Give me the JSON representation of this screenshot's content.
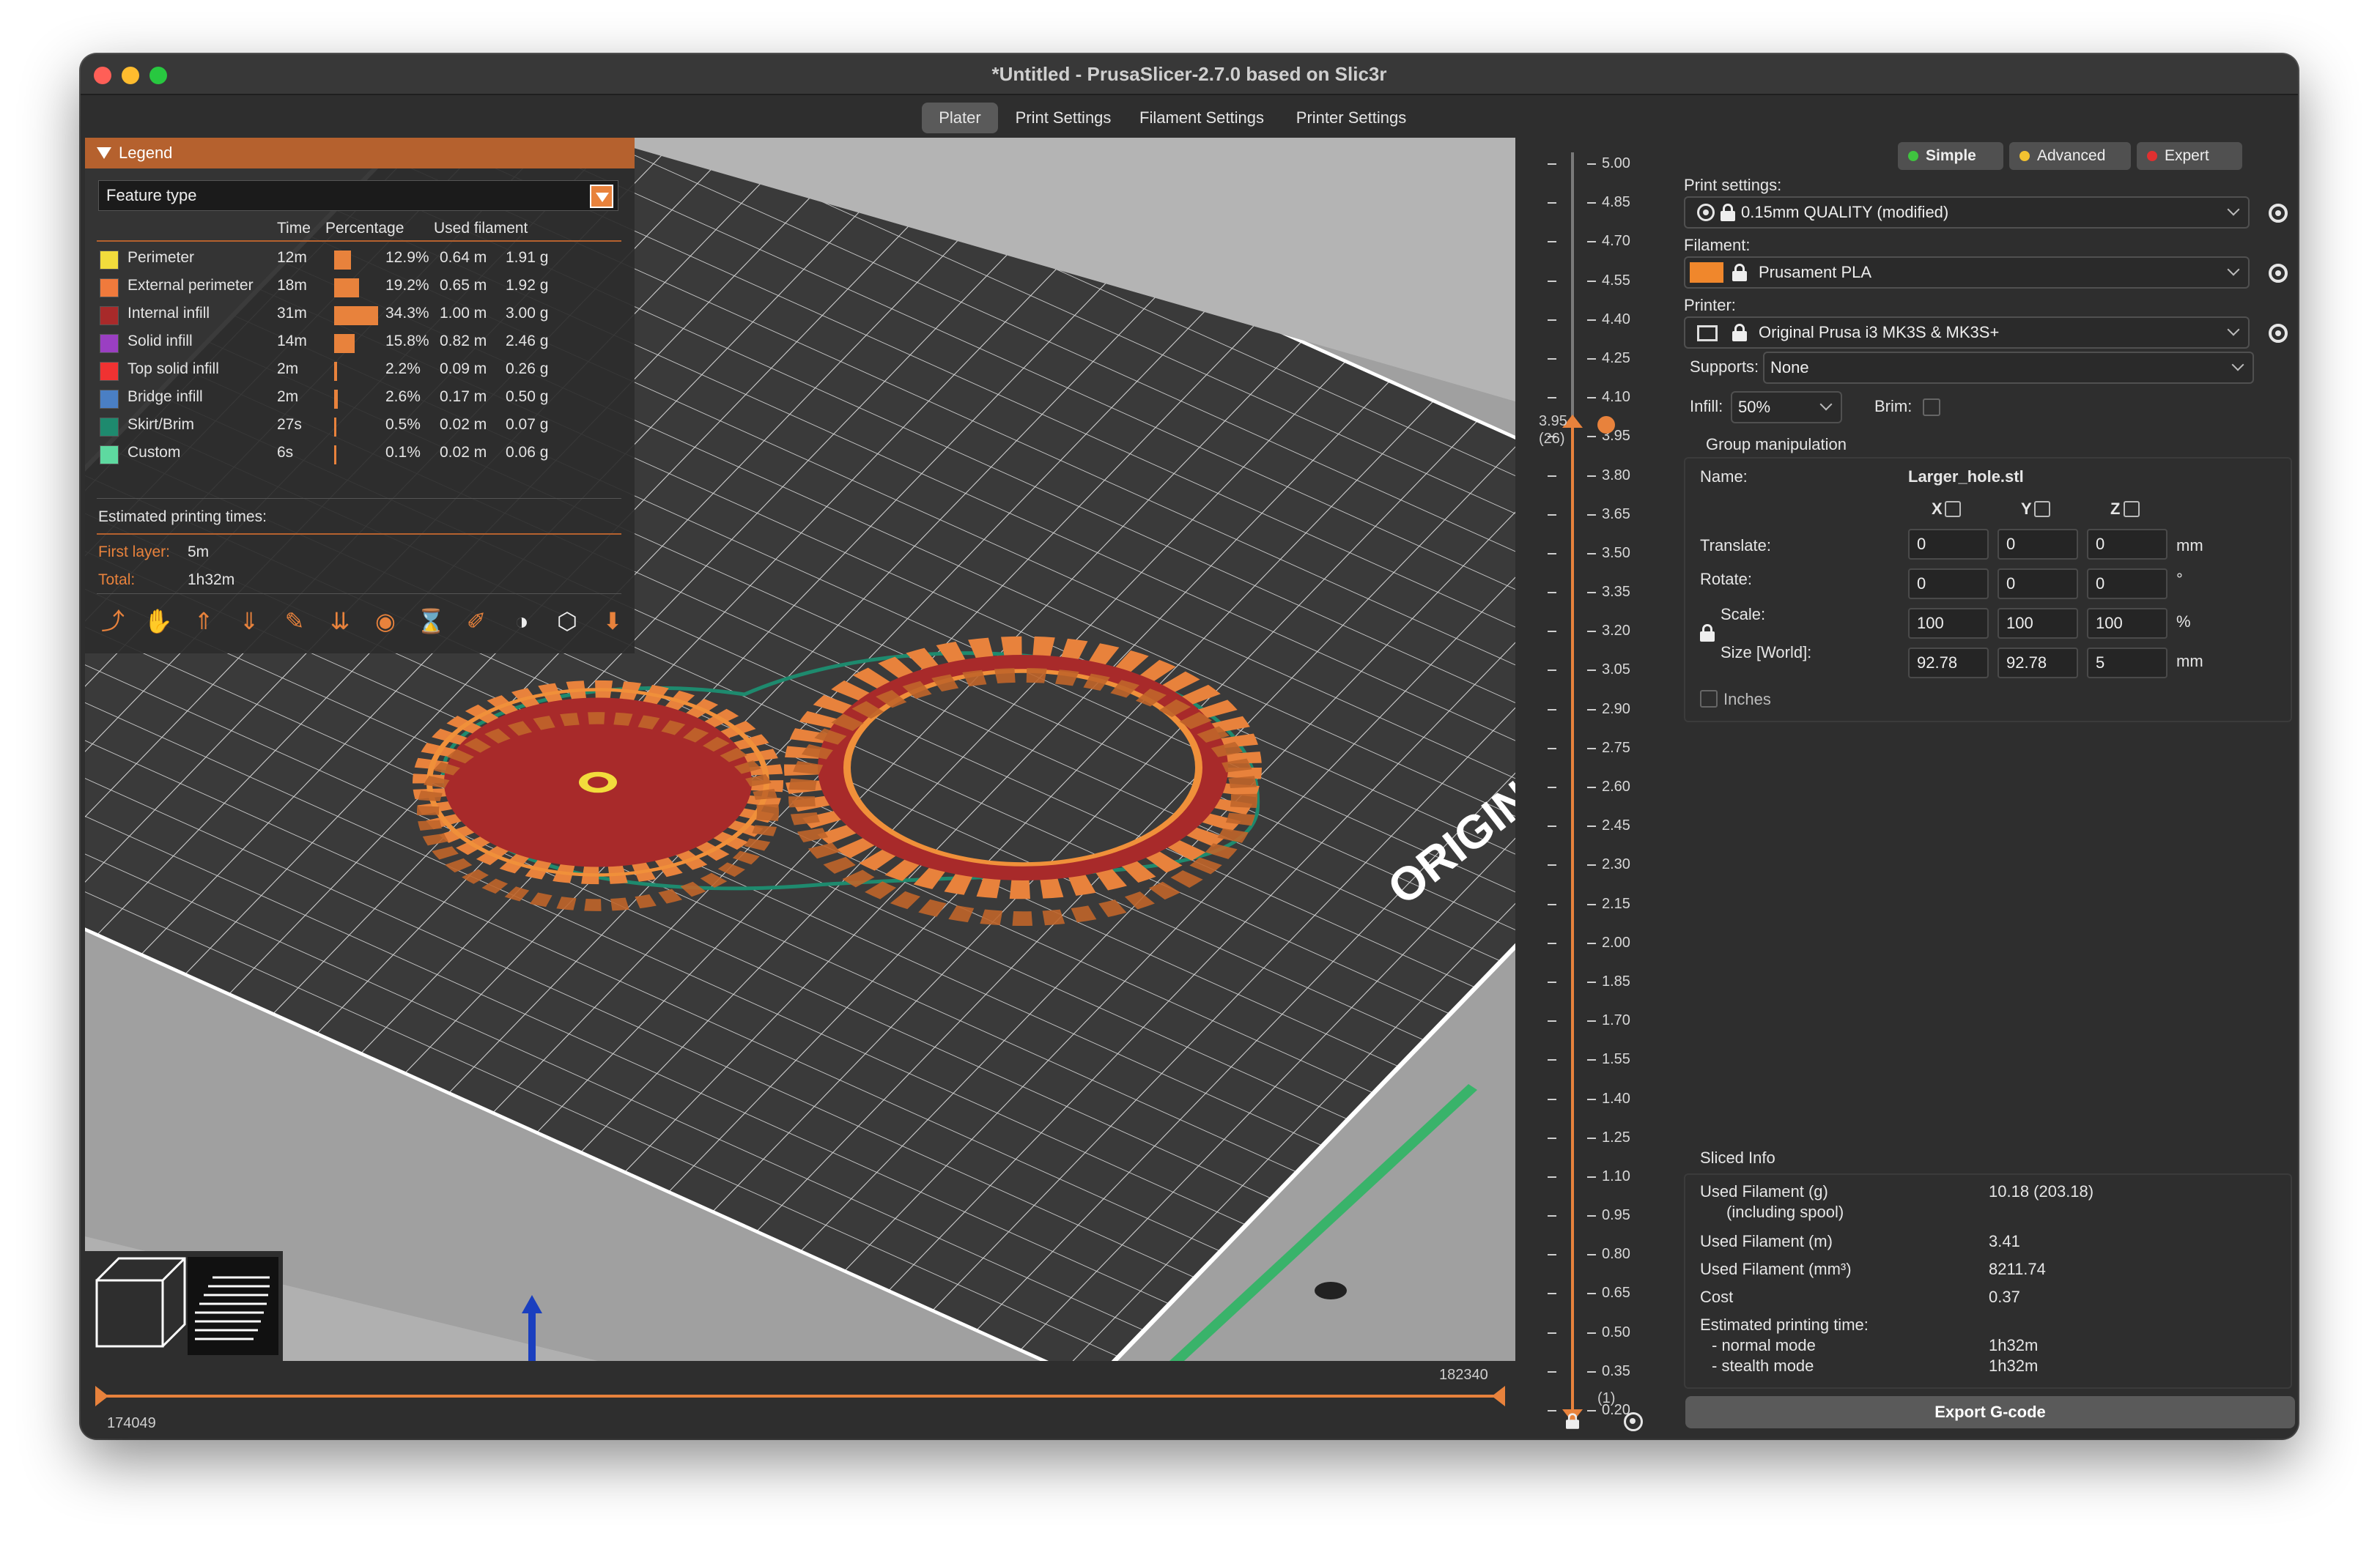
{
  "window": {
    "title": "*Untitled - PrusaSlicer-2.7.0 based on Slic3r"
  },
  "tabs": [
    {
      "label": "Plater"
    },
    {
      "label": "Print Settings"
    },
    {
      "label": "Filament Settings"
    },
    {
      "label": "Printer Settings"
    }
  ],
  "legend": {
    "header": "Legend",
    "feature_select": "Feature type",
    "columns": {
      "time": "Time",
      "percentage": "Percentage",
      "filament": "Used filament"
    },
    "rows": [
      {
        "name": "Perimeter",
        "time": "12m",
        "pct": "12.9%",
        "pct_value": 12.9,
        "len": "0.64 m",
        "weight": "1.91 g",
        "color": "#f2dc3c"
      },
      {
        "name": "External perimeter",
        "time": "18m",
        "pct": "19.2%",
        "pct_value": 19.2,
        "len": "0.65 m",
        "weight": "1.92 g",
        "color": "#f07a3c"
      },
      {
        "name": "Internal infill",
        "time": "31m",
        "pct": "34.3%",
        "pct_value": 34.3,
        "len": "1.00 m",
        "weight": "3.00 g",
        "color": "#a82a2a"
      },
      {
        "name": "Solid infill",
        "time": "14m",
        "pct": "15.8%",
        "pct_value": 15.8,
        "len": "0.82 m",
        "weight": "2.46 g",
        "color": "#9a3fc2"
      },
      {
        "name": "Top solid infill",
        "time": "2m",
        "pct": "2.2%",
        "pct_value": 2.2,
        "len": "0.09 m",
        "weight": "0.26 g",
        "color": "#f03232"
      },
      {
        "name": "Bridge infill",
        "time": "2m",
        "pct": "2.6%",
        "pct_value": 2.6,
        "len": "0.17 m",
        "weight": "0.50 g",
        "color": "#4a7fc4"
      },
      {
        "name": "Skirt/Brim",
        "time": "27s",
        "pct": "0.5%",
        "pct_value": 0.5,
        "len": "0.02 m",
        "weight": "0.07 g",
        "color": "#1e8a6e"
      },
      {
        "name": "Custom",
        "time": "6s",
        "pct": "0.1%",
        "pct_value": 0.1,
        "len": "0.02 m",
        "weight": "0.06 g",
        "color": "#5ed9a0"
      }
    ],
    "est_title": "Estimated printing times:",
    "first_layer_label": "First layer:",
    "first_layer_value": "5m",
    "total_label": "Total:",
    "total_value": "1h32m"
  },
  "toolbar_icons": [
    "travel-icon",
    "wipe-icon",
    "retractions-icon",
    "deretractions-icon",
    "seams-icon",
    "tool-changes-icon",
    "color-changes-icon",
    "pause-prints-icon",
    "custom-gcode-icon",
    "center-of-gravity-icon",
    "shells-icon",
    "tool-marker-icon"
  ],
  "hslider": {
    "left_value": "174049",
    "right_value": "182340"
  },
  "vslider": {
    "ticks": [
      "5.00",
      "4.85",
      "4.70",
      "4.55",
      "4.40",
      "4.25",
      "4.10",
      "3.95",
      "3.80",
      "3.65",
      "3.50",
      "3.35",
      "3.20",
      "3.05",
      "2.90",
      "2.75",
      "2.60",
      "2.45",
      "2.30",
      "2.15",
      "2.00",
      "1.85",
      "1.70",
      "1.55",
      "1.40",
      "1.25",
      "1.10",
      "0.95",
      "0.80",
      "0.65",
      "0.50",
      "0.35",
      "0.20"
    ],
    "upper_label": "3.95",
    "upper_layer": "(26)",
    "lower_layer": "(1)"
  },
  "bed_label": "ORIGINAL P",
  "right_panel": {
    "modes": [
      {
        "label": "Simple",
        "color": "#3fc43f"
      },
      {
        "label": "Advanced",
        "color": "#f2c230"
      },
      {
        "label": "Expert",
        "color": "#e03030"
      }
    ],
    "print_settings_label": "Print settings:",
    "print_settings_value": "0.15mm QUALITY (modified)",
    "filament_label": "Filament:",
    "filament_value": "Prusament PLA",
    "filament_color": "#f0872c",
    "printer_label": "Printer:",
    "printer_value": "Original Prusa i3 MK3S & MK3S+",
    "supports_label": "Supports:",
    "supports_value": "None",
    "infill_label": "Infill:",
    "infill_value": "50%",
    "brim_label": "Brim:",
    "group_title": "Group manipulation",
    "name_label": "Name:",
    "name_value": "Larger_hole.stl",
    "axes": [
      "X",
      "Y",
      "Z"
    ],
    "translate_label": "Translate:",
    "translate": [
      "0",
      "0",
      "0"
    ],
    "translate_unit": "mm",
    "rotate_label": "Rotate:",
    "rotate": [
      "0",
      "0",
      "0"
    ],
    "rotate_unit": "°",
    "scale_label": "Scale:",
    "scale": [
      "100",
      "100",
      "100"
    ],
    "scale_unit": "%",
    "size_label": "Size [World]:",
    "size": [
      "92.78",
      "92.78",
      "5"
    ],
    "size_unit": "mm",
    "inches_label": "Inches"
  },
  "sliced_info": {
    "title": "Sliced Info",
    "used_g_label": "Used Filament (g)",
    "used_g_sub": "(including spool)",
    "used_g_value": "10.18 (203.18)",
    "used_m_label": "Used Filament (m)",
    "used_m_value": "3.41",
    "used_mm3_label": "Used Filament (mm³)",
    "used_mm3_value": "8211.74",
    "cost_label": "Cost",
    "cost_value": "0.37",
    "est_label": "Estimated printing time:",
    "normal_label": "- normal mode",
    "normal_value": "1h32m",
    "stealth_label": "- stealth mode",
    "stealth_value": "1h32m"
  },
  "export_label": "Export G-code"
}
